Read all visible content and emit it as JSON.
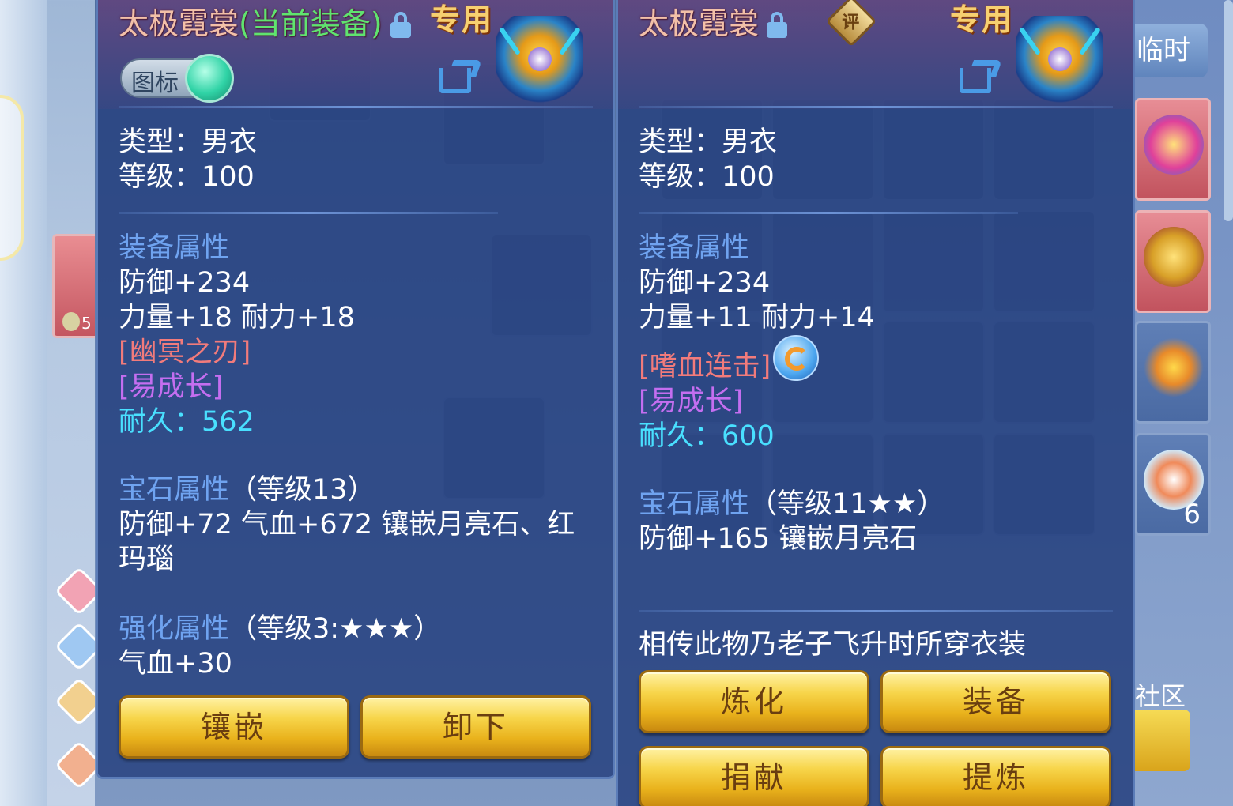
{
  "left_panel": {
    "title": "太极霓裳",
    "title_equipped": "(当前装备)",
    "exclusive": "专用",
    "toggle_label": "图标",
    "type_line": "类型：男衣",
    "level_line": "等级：100",
    "equip_attr_header": "装备属性",
    "defense": "防御+234",
    "str_end": "力量+18 耐力+18",
    "special_skill": "[幽冥之刃]",
    "special_effect": "[易成长]",
    "durability_label": "耐久：",
    "durability_value": "562",
    "gem_header": "宝石属性",
    "gem_level": "（等级13）",
    "gem_stats": "防御+72 气血+672 镶嵌月亮石、红玛瑙",
    "enhance_header": "强化属性",
    "enhance_level": "（等级3:★★★）",
    "enhance_stats": "气血+30",
    "buttons": [
      "镶嵌",
      "卸下"
    ]
  },
  "right_panel": {
    "title": "太极霓裳",
    "rating_badge": "评",
    "exclusive": "专用",
    "type_line": "类型：男衣",
    "level_line": "等级：100",
    "equip_attr_header": "装备属性",
    "defense": "防御+234",
    "str_end": "力量+11 耐力+14",
    "special_skill": "[嗜血连击]",
    "special_effect": "[易成长]",
    "durability_label": "耐久：",
    "durability_value": "600",
    "gem_header": "宝石属性",
    "gem_level": "（等级11★★）",
    "gem_stats": "防御+165 镶嵌月亮石",
    "description": "相传此物乃老子飞升时所穿衣装",
    "buttons": [
      "炼化",
      "装备",
      "捐献",
      "提炼"
    ]
  },
  "background": {
    "right_tab": "临时",
    "right_slot_count": "6",
    "community": "社区",
    "side_count": "5"
  },
  "colors": {
    "title": "#f2c0a8",
    "equipped": "#5fe46f",
    "exclusive": "#f7d070",
    "section": "#6fa3f0",
    "special_skill": "#f27b7b",
    "special_effect": "#c46ef0",
    "durability": "#49e0ff",
    "button": "#f7d54a"
  }
}
